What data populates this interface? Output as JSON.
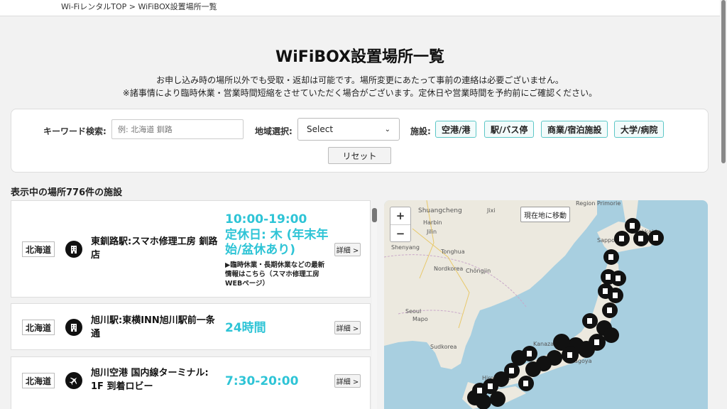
{
  "breadcrumb": "Wi-FiレンタルTOP > WiFiBOX設置場所一覧",
  "title": "WiFiBOX設置場所一覧",
  "notices": [
    "お申し込み時の場所以外でも受取・返却は可能です。場所変更にあたって事前の連絡は必要ございません。",
    "※諸事情により臨時休業・営業時間短縮をさせていただく場合がございます。定休日や営業時間を予約前にご確認ください。"
  ],
  "search": {
    "keyword_label": "キーワード検索:",
    "keyword_placeholder": "例: 北海道 釧路",
    "region_label": "地域選択:",
    "region_selected": "Select",
    "facility_label": "施設:",
    "facility_filters": [
      "空港/港",
      "駅/バス停",
      "商業/宿泊施設",
      "大学/病院"
    ],
    "reset_label": "リセット"
  },
  "count_label": "表示中の場所776件の施設",
  "locations": [
    {
      "region": "北海道",
      "icon": "building-icon",
      "name": "東釧路駅:スマホ修理工房 釧路店",
      "hours": "10:00-19:00",
      "closed": "定休日: 木 (年末年始/盆休あり)",
      "note": "▶臨時休業・長期休業などの最新情報はこちら（スマホ修理工房WEBページ）",
      "detail": "詳細 >"
    },
    {
      "region": "北海道",
      "icon": "building-icon",
      "name": "旭川駅:東横INN旭川駅前一条通",
      "hours": "24時間",
      "detail": "詳細 >"
    },
    {
      "region": "北海道",
      "icon": "airplane-icon",
      "name": "旭川空港 国内線ターミナル: 1F 到着ロビー",
      "hours": "7:30-20:00",
      "detail": "詳細 >"
    }
  ],
  "map": {
    "zoom_in": "+",
    "zoom_out": "−",
    "locate_label": "現在地に移動",
    "labels": [
      "Region Primorie",
      "Shuangcheng",
      "Jixi",
      "Harbin",
      "Jilin",
      "Shenyang",
      "Tonghua",
      "Nordkorea",
      "Chŏngjin",
      "Sapporo",
      "Hokkaido",
      "Seoul",
      "Mapo",
      "Sudkorea",
      "Kanazawa",
      "Hiroshima",
      "Nagoya"
    ],
    "colors": {
      "water": "#a8cfe0",
      "land": "#ece9df",
      "marker": "#111111"
    }
  }
}
